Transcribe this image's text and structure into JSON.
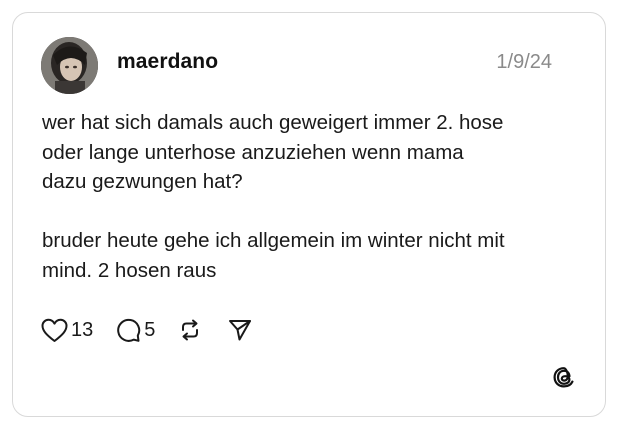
{
  "post": {
    "username": "maerdano",
    "date": "1/9/24",
    "text": "wer hat sich damals auch geweigert immer 2. hose\noder lange unterhose anzuziehen wenn mama\ndazu gezwungen hat?\n\nbruder heute gehe ich allgemein im winter nicht mit\nmind. 2 hosen raus",
    "likes": "13",
    "replies": "5"
  },
  "icons": {
    "like": "heart-icon",
    "reply": "comment-icon",
    "repost": "repost-icon",
    "share": "send-icon",
    "brand": "threads-logo-icon"
  },
  "colors": {
    "card_border": "#d9d9d9",
    "text": "#1a1a1a",
    "date": "#8a8a8a"
  }
}
